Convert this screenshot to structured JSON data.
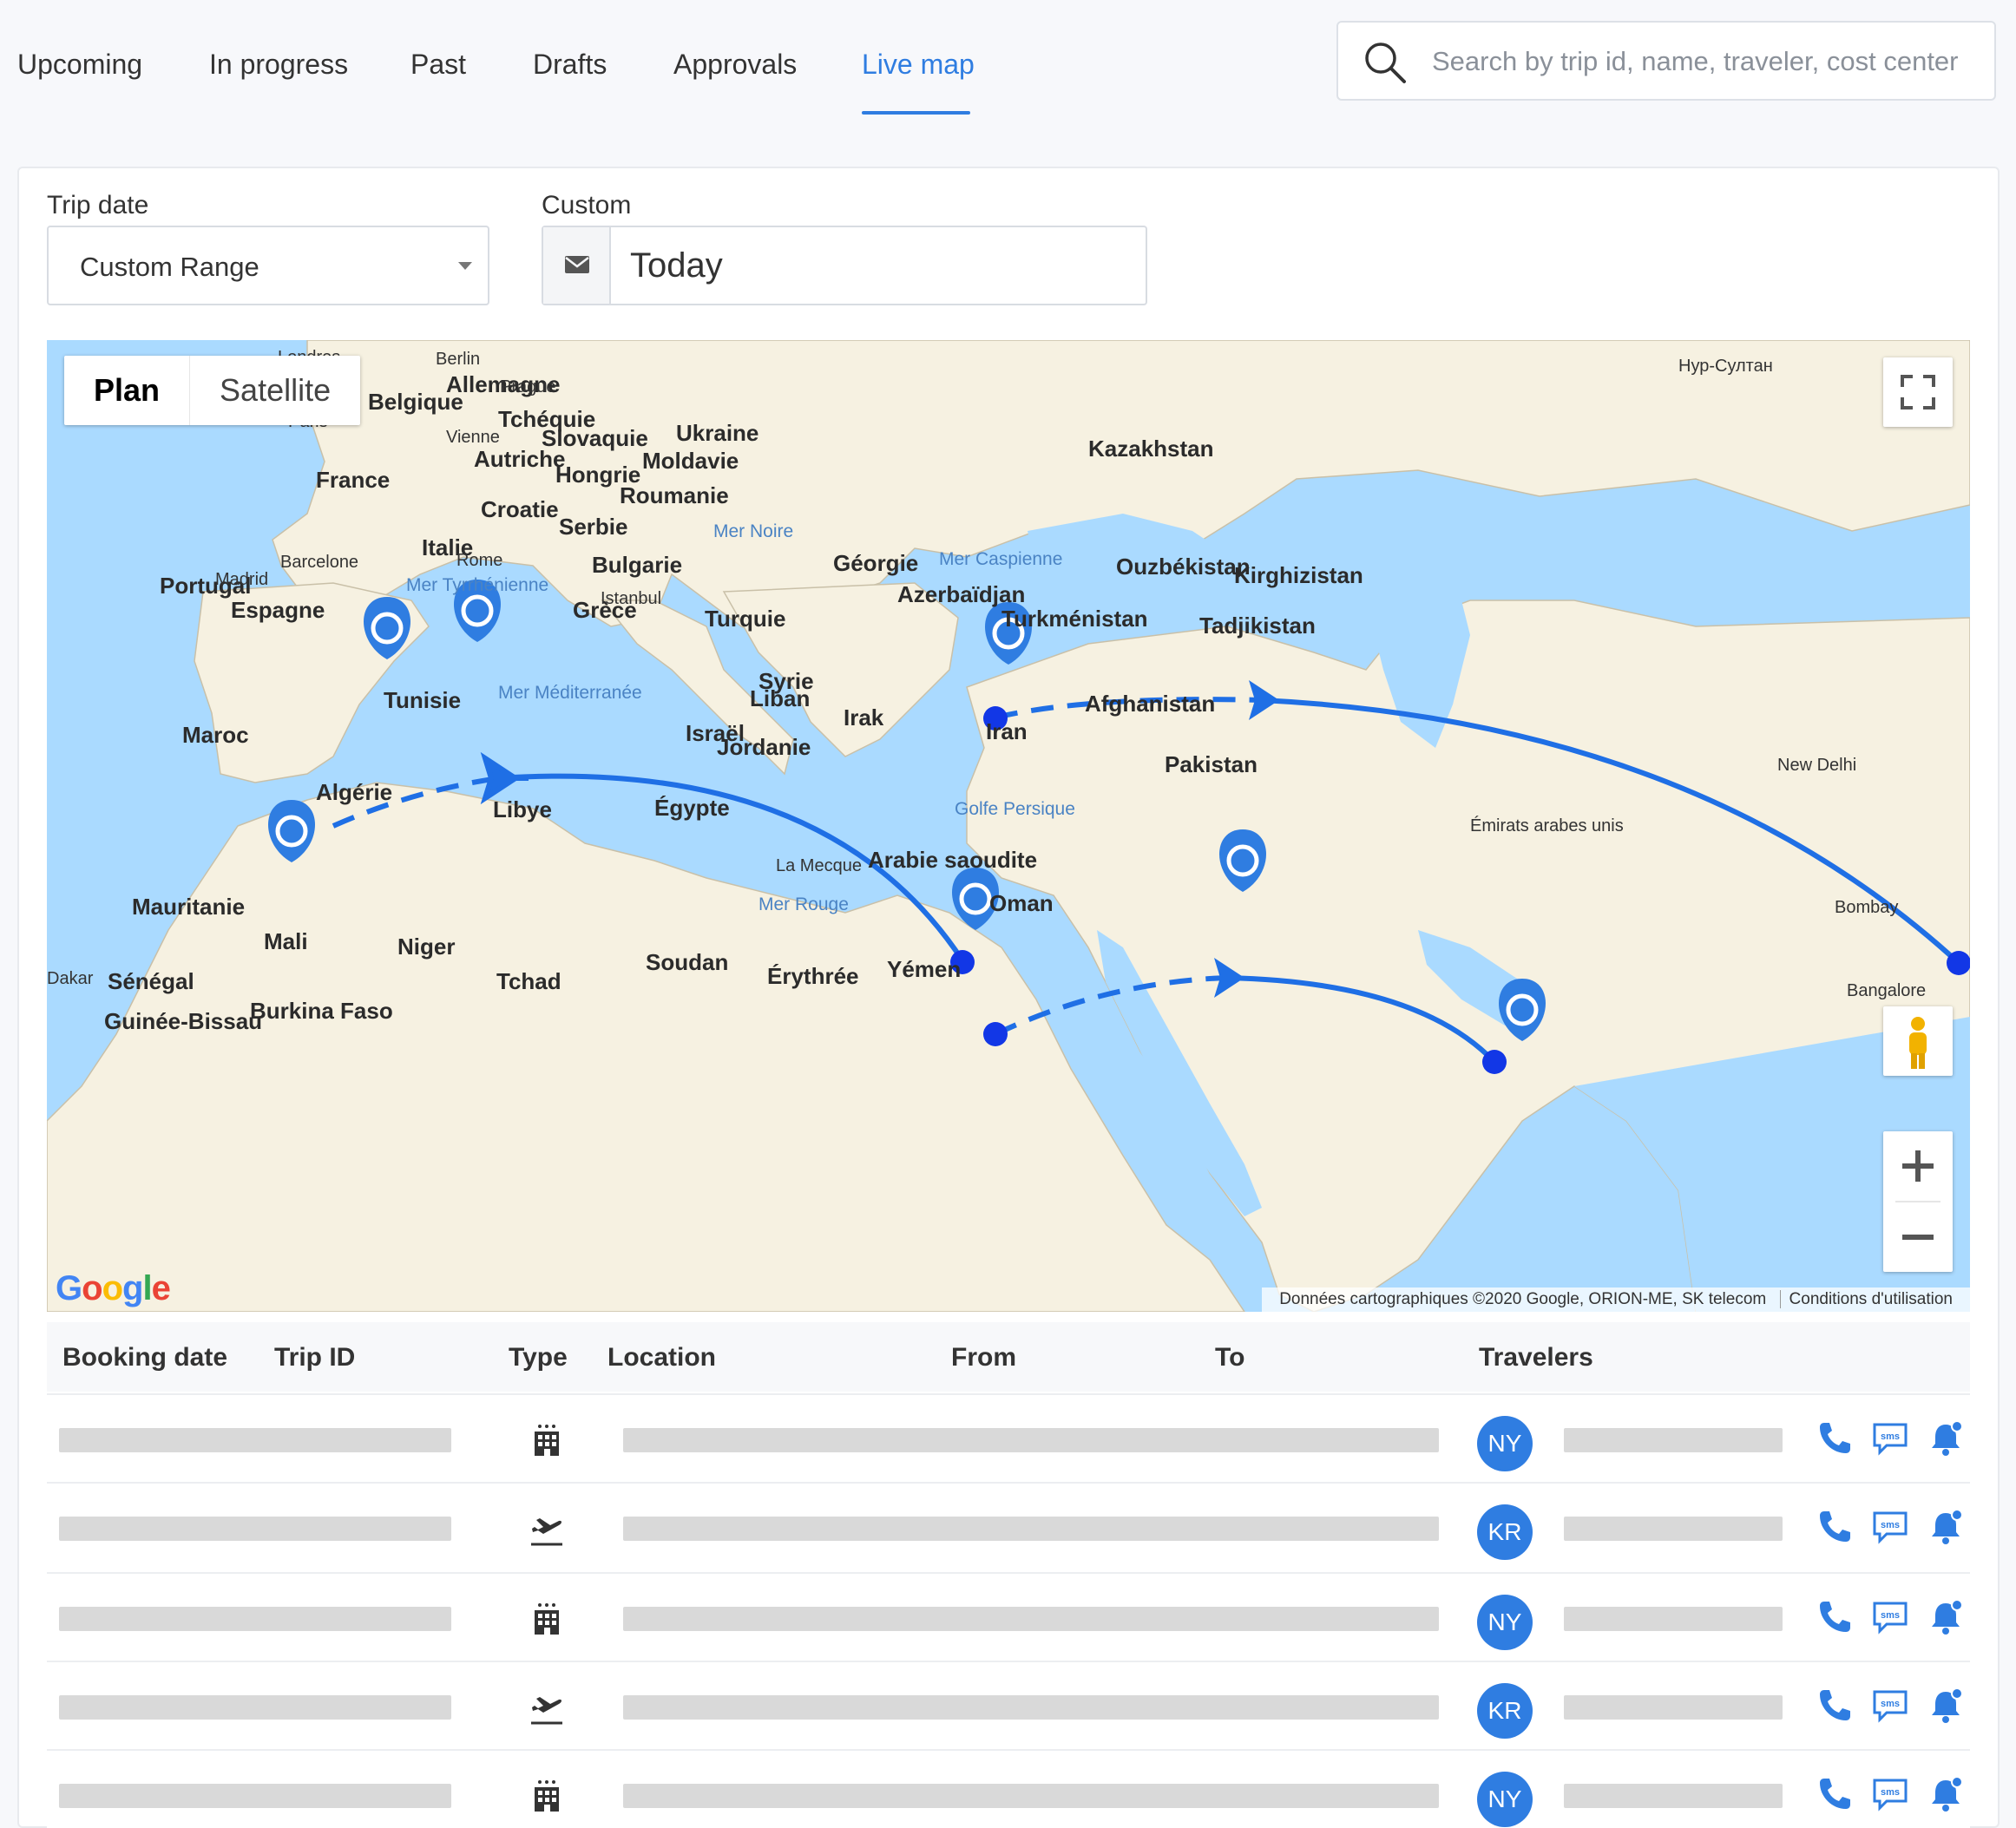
{
  "tabs": [
    {
      "label": "Upcoming",
      "active": false
    },
    {
      "label": "In progress",
      "active": false
    },
    {
      "label": "Past",
      "active": false
    },
    {
      "label": "Drafts",
      "active": false
    },
    {
      "label": "Approvals",
      "active": false
    },
    {
      "label": "Live map",
      "active": true
    }
  ],
  "search": {
    "placeholder": "Search by trip id, name, traveler, cost center",
    "value": ""
  },
  "filters": {
    "trip_date_label": "Trip date",
    "trip_date_value": "Custom Range",
    "custom_label": "Custom",
    "custom_value": "Today"
  },
  "map": {
    "type_plan": "Plan",
    "type_satellite": "Satellite",
    "attribution": "Données cartographiques ©2020 Google, ORION-ME, SK telecom",
    "terms": "Conditions d'utilisation",
    "logo": "Google",
    "labels": {
      "countries": [
        "Allemagne",
        "Belgique",
        "Tchéquie",
        "Slovaquie",
        "Autriche",
        "Hongrie",
        "Ukraine",
        "Moldavie",
        "Roumanie",
        "France",
        "Croatie",
        "Serbie",
        "Italie",
        "Bulgarie",
        "Portugal",
        "Espagne",
        "Grèce",
        "Turquie",
        "Géorgie",
        "Azerbaïdjan",
        "Kazakhstan",
        "Ouzbékistan",
        "Kirghizistan",
        "Turkménistan",
        "Tadjikistan",
        "Tunisie",
        "Syrie",
        "Liban",
        "Irak",
        "Iran",
        "Afghanistan",
        "Pakistan",
        "Maroc",
        "Israël",
        "Jordanie",
        "Algérie",
        "Libye",
        "Égypte",
        "Arabie saoudite",
        "Oman",
        "Mauritanie",
        "Mali",
        "Niger",
        "Tchad",
        "Soudan",
        "Érythrée",
        "Yémen",
        "Sénégal",
        "Burkina Faso",
        "Guinée-Bissau"
      ],
      "cities": [
        "Londres",
        "Berlin",
        "Prague",
        "Paris",
        "Vienne",
        "Rome",
        "Madrid",
        "Barcelone",
        "Istanbul",
        "New Delhi",
        "Нур-Султан",
        "La Mecque",
        "Émirats arabes unis",
        "Bombay",
        "Bangalore",
        "Dakar"
      ],
      "water": [
        "Mer Noire",
        "Mer Caspienne",
        "Mer Tyrrhénienne",
        "Mer Méditerranée",
        "Golfe Persique",
        "Mer Rouge"
      ]
    }
  },
  "table": {
    "headers": [
      "Booking date",
      "Trip ID",
      "Type",
      "Location",
      "From",
      "To",
      "Travelers"
    ],
    "rows": [
      {
        "type": "hotel-icon",
        "initials": "NY"
      },
      {
        "type": "flight-icon",
        "initials": "KR"
      },
      {
        "type": "hotel-icon",
        "initials": "NY"
      },
      {
        "type": "flight-icon",
        "initials": "KR"
      },
      {
        "type": "hotel-icon",
        "initials": "NY"
      }
    ]
  },
  "colors": {
    "accent": "#2f7de1",
    "route": "#1f6fe5",
    "water": "#aadaff",
    "land": "#f6f1e1"
  }
}
